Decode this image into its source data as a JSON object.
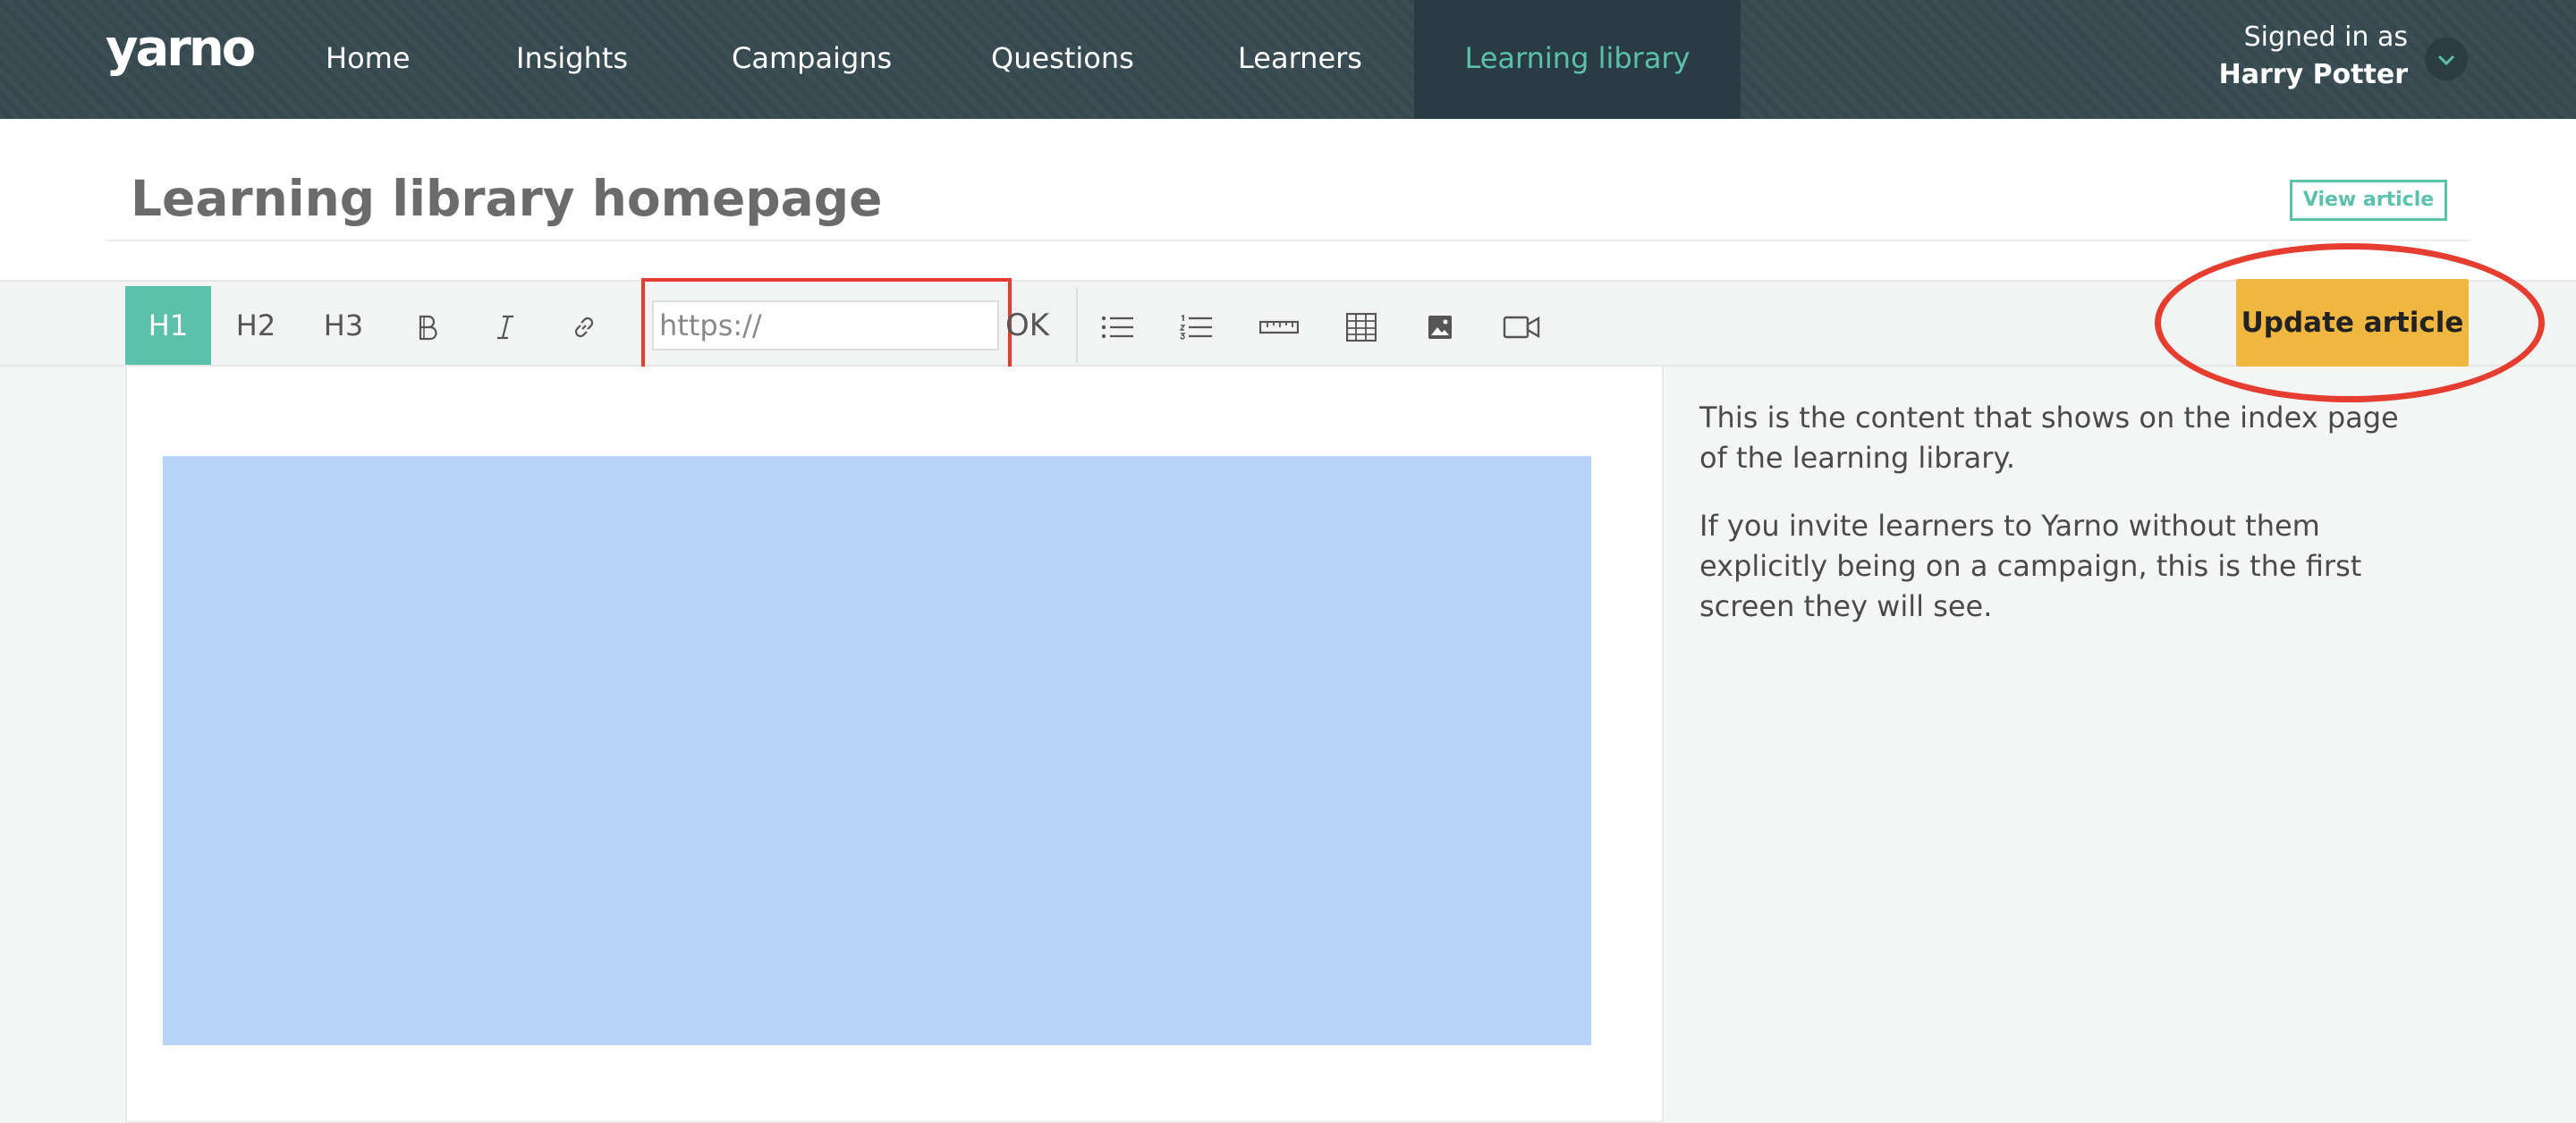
{
  "nav": {
    "logo": "yarno",
    "items": [
      {
        "label": "Home"
      },
      {
        "label": "Insights"
      },
      {
        "label": "Campaigns"
      },
      {
        "label": "Questions"
      },
      {
        "label": "Learners"
      },
      {
        "label": "Learning library",
        "active": true
      }
    ],
    "signed_in_label": "Signed in as",
    "user_name": "Harry Potter",
    "user_menu_icon": "chevron-down-icon"
  },
  "header": {
    "title": "Learning library homepage",
    "view_article_label": "View article"
  },
  "toolbar": {
    "h1": "H1",
    "h2": "H2",
    "h3": "H3",
    "bold_icon": "bold-icon",
    "italic_icon": "italic-icon",
    "link_icon": "link-icon",
    "url_placeholder": "https://",
    "ok_label": "OK",
    "bullet_list_icon": "bullet-list-icon",
    "numbered_list_icon": "numbered-list-icon",
    "rule_icon": "horizontal-rule-icon",
    "table_icon": "table-icon",
    "image_icon": "image-icon",
    "video_icon": "video-icon",
    "update_label": "Update article"
  },
  "sidebar": {
    "paragraphs": [
      "This is the content that shows on the index page of the learning library.",
      "If you invite learners to Yarno without them explicitly being on a campaign, this is the first screen they will see."
    ]
  },
  "colors": {
    "nav_bg": "#374a51",
    "accent": "#5cc1aa",
    "update_button": "#efb740",
    "annotation": "#e53d2f",
    "media_placeholder": "#b7d3f7"
  }
}
